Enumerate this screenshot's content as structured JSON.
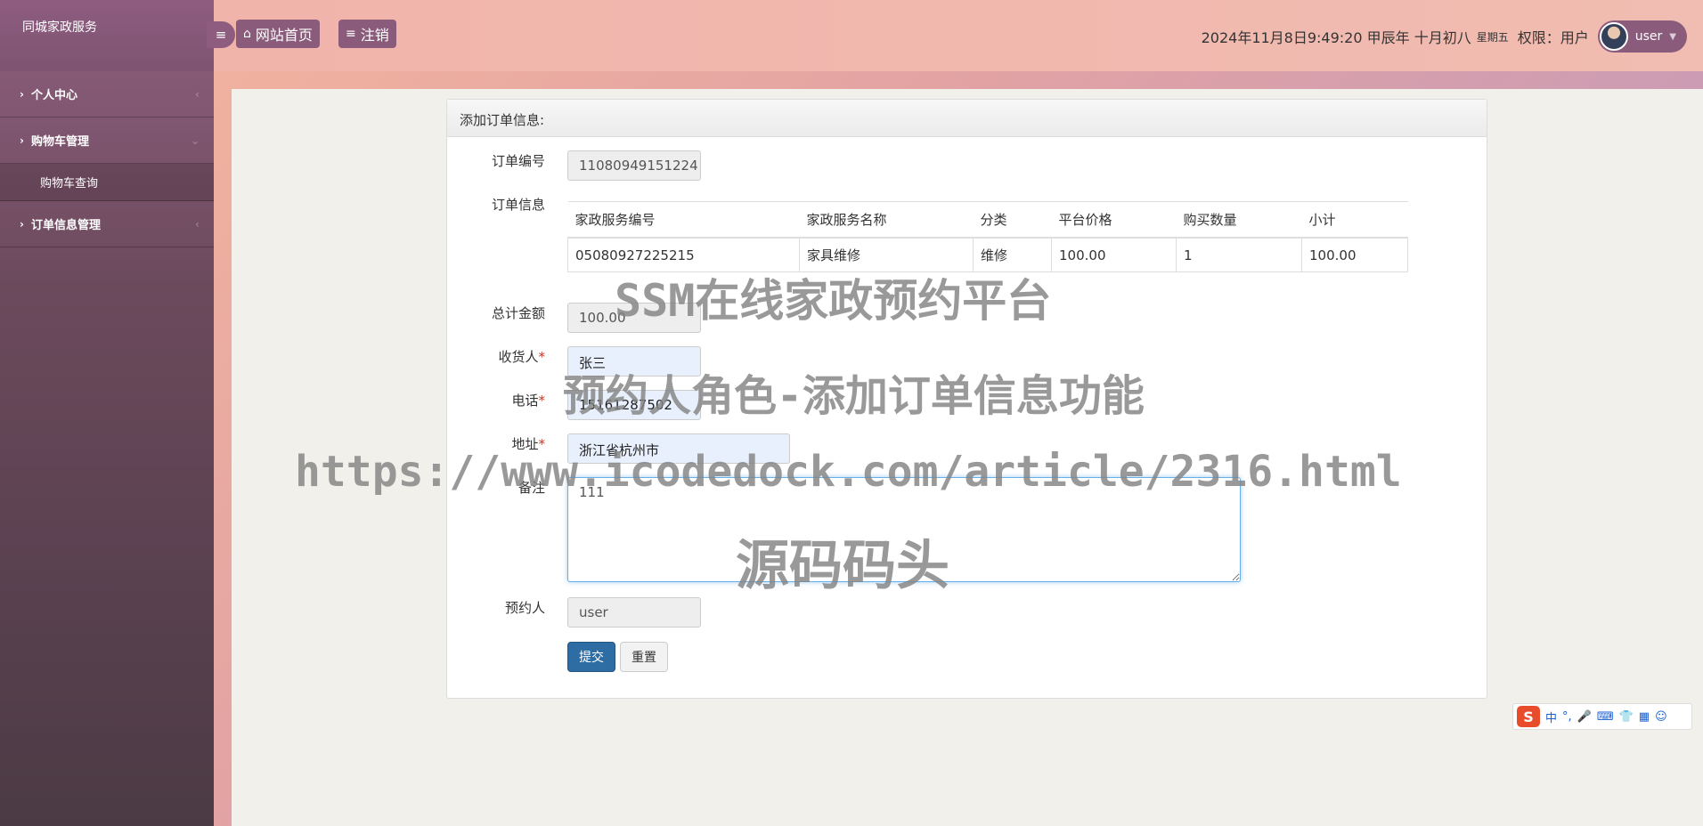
{
  "sidebar": {
    "brand": "同城家政服务",
    "items": [
      {
        "label": "个人中心"
      },
      {
        "label": "购物车管理",
        "sub": [
          "购物车查询"
        ]
      },
      {
        "label": "订单信息管理"
      }
    ]
  },
  "topbar": {
    "home_label": "网站首页",
    "logout_label": "注销",
    "datetime": "2024年11月8日9:49:20 甲辰年 十月初八",
    "weekday": "星期五",
    "permission": "权限：用户",
    "username": "user"
  },
  "form": {
    "panel_title": "添加订单信息:",
    "order_no_label": "订单编号",
    "order_no": "11080949151224",
    "order_info_label": "订单信息",
    "table": {
      "headers": [
        "家政服务编号",
        "家政服务名称",
        "分类",
        "平台价格",
        "购买数量",
        "小计"
      ],
      "rows": [
        [
          "05080927225215",
          "家具维修",
          "维修",
          "100.00",
          "1",
          "100.00"
        ]
      ]
    },
    "total_label": "总计金额",
    "total": "100.00",
    "consignee_label": "收货人",
    "consignee": "张三",
    "phone_label": "电话",
    "phone": "15161287502",
    "address_label": "地址",
    "address": "浙江省杭州市",
    "note_label": "备注",
    "note": "111",
    "booker_label": "预约人",
    "booker": "user",
    "submit_label": "提交",
    "reset_label": "重置"
  },
  "watermarks": {
    "line1": "SSM在线家政预约平台",
    "line2": "预约人角色-添加订单信息功能",
    "line3": "https://www.icodedock.com/article/2316.html",
    "line4": "源码码头"
  },
  "ime": {
    "items": [
      "中",
      "°,",
      "🎤",
      "⌨",
      "👕",
      "▦",
      "☺"
    ]
  }
}
